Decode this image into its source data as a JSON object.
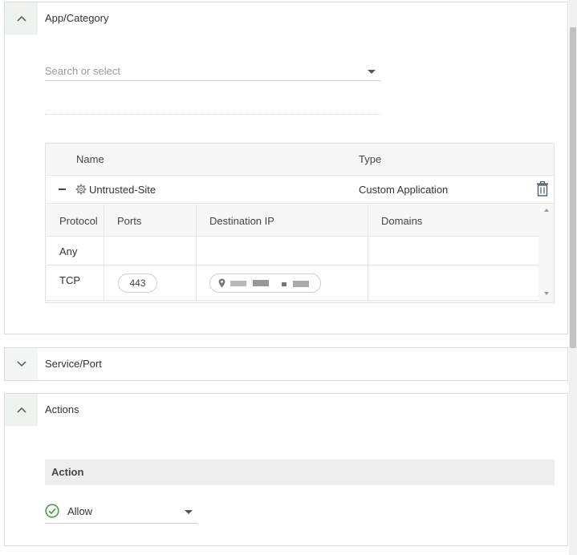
{
  "app_category": {
    "title": "App/Category",
    "search_placeholder": "Search or select",
    "table": {
      "headers": {
        "name": "Name",
        "type": "Type"
      },
      "row": {
        "name": "Untrusted-Site",
        "type": "Custom Application"
      },
      "sub_headers": [
        "Protocol",
        "Ports",
        "Destination IP",
        "Domains"
      ],
      "sub_rows": [
        {
          "protocol": "Any",
          "ports": "",
          "destination_ip": "",
          "domains": ""
        },
        {
          "protocol": "TCP",
          "ports": "443",
          "destination_ip": "",
          "domains": ""
        }
      ]
    }
  },
  "service_port": {
    "title": "Service/Port"
  },
  "actions": {
    "title": "Actions",
    "column_header": "Action",
    "selected": "Allow"
  },
  "colors": {
    "allow": "#43a047",
    "icon": "#555555",
    "trash": "#4a5a6a"
  },
  "icons": [
    "chevron-up-icon",
    "chevron-down-icon",
    "gear-icon",
    "trash-icon",
    "location-pin-icon",
    "check-circle-icon",
    "caret-down-icon"
  ]
}
